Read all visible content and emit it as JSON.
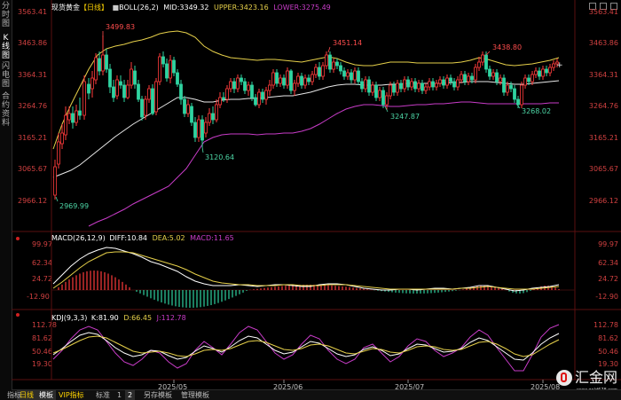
{
  "window": {
    "symbol": "现货黄金",
    "period": "【日线】",
    "top_icons": [
      "window-icon",
      "grid-icon",
      "settings-icon"
    ]
  },
  "sidebar": {
    "tabs": [
      {
        "label": "分时图",
        "name": "sidebar-tab-intraday"
      },
      {
        "label": "K线图",
        "name": "sidebar-tab-kline"
      },
      {
        "label": "闪电图",
        "name": "sidebar-tab-flash"
      },
      {
        "label": "合约资料",
        "name": "sidebar-tab-contract"
      }
    ]
  },
  "main": {
    "boll_label": "BOLL(26,2)",
    "mid_label": "MID:3349.32",
    "upper_label": "UPPER:3423.16",
    "lower_label": "LOWER:3275.49",
    "price_ticks": [
      "3563.41",
      "3463.86",
      "3364.31",
      "3264.76",
      "3165.21",
      "3065.67",
      "2966.12"
    ],
    "annotations": [
      {
        "text": "3499.83",
        "color": "#ff4d4d"
      },
      {
        "text": "3451.14",
        "color": "#ff4d4d"
      },
      {
        "text": "3438.80",
        "color": "#ff4d4d"
      },
      {
        "text": "3247.87",
        "color": "#4dd6a6"
      },
      {
        "text": "3268.02",
        "color": "#4dd6a6"
      },
      {
        "text": "3120.64",
        "color": "#4dd6a6"
      },
      {
        "text": "2969.99",
        "color": "#4dd6a6"
      }
    ]
  },
  "macd": {
    "title": "MACD(26,12,9)",
    "diff": "DIFF:10.84",
    "dea": "DEA:5.02",
    "macd": "MACD:11.65",
    "ticks": [
      "99.97",
      "62.34",
      "24.72",
      "-12.90"
    ]
  },
  "kdj": {
    "title": "KDJ(9,3,3)",
    "k": "K:81.90",
    "d": "D:66.45",
    "j": "J:112.78",
    "ticks": [
      "112.78",
      "81.62",
      "50.46",
      "19.30"
    ]
  },
  "dates": [
    "2025/05",
    "2025/06",
    "2025/07",
    "2025/08"
  ],
  "bottom_tabs": [
    {
      "label": "日线",
      "name": "tab-daily"
    },
    {
      "label": "指标",
      "name": "tab-indicator"
    },
    {
      "label": "模板",
      "name": "tab-template"
    },
    {
      "label": "VIP指标",
      "name": "tab-vip"
    },
    {
      "label": "标准",
      "name": "tab-standard"
    },
    {
      "label": "1",
      "name": "tab-page-1"
    },
    {
      "label": "2",
      "name": "tab-page-2"
    },
    {
      "label": "另存模板",
      "name": "tab-save-template"
    },
    {
      "label": "管理模板",
      "name": "tab-manage-template"
    }
  ],
  "logo": {
    "text": "汇金网",
    "url": "www.gold678.com"
  },
  "colors": {
    "up": "#ff3b3b",
    "down": "#2fd3a0",
    "mid": "#ffffff",
    "upper": "#e6d04a",
    "lower": "#c83cc8",
    "axis": "#d04040"
  }
}
